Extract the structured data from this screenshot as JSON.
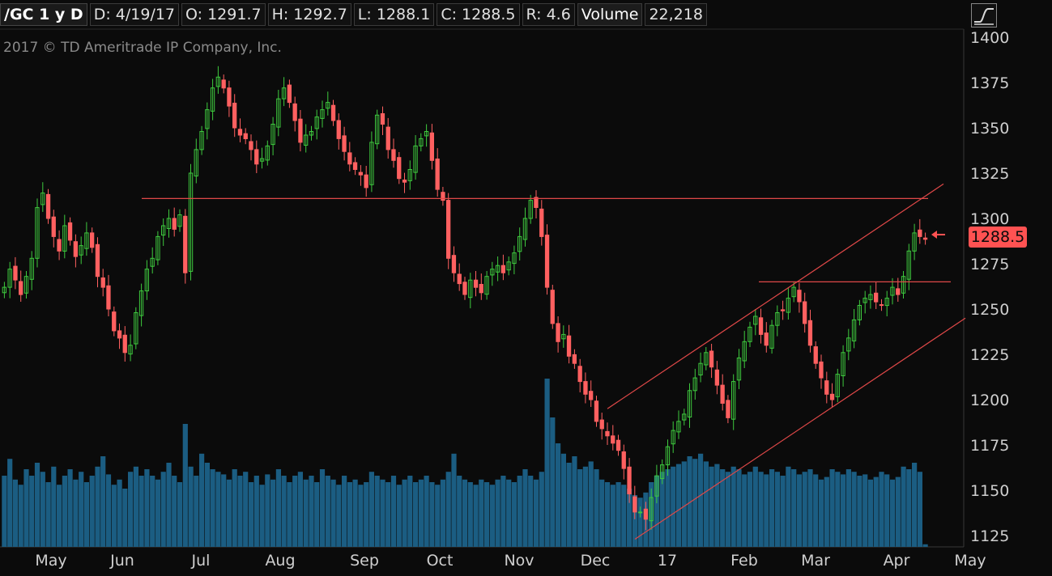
{
  "header": {
    "symbol": "/GC 1 y D",
    "date": "D: 4/19/17",
    "open": "O: 1291.7",
    "high": "H: 1292.7",
    "low": "L: 1288.1",
    "close": "C: 1288.5",
    "range": "R: 4.6",
    "volume_label": "Volume",
    "volume_value": "22,218"
  },
  "copyright": "2017 © TD Ameritrade IP Company, Inc.",
  "icons": {
    "study_button": "line-curve-icon",
    "price_arrow": "left-arrow-icon"
  },
  "colors": {
    "background": "#0b0b0b",
    "up": "#3ec93e",
    "down": "#ff6060",
    "volume": "#1b5d82",
    "trendline": "#e04848",
    "badge": "#ff5252"
  },
  "chart_data": {
    "type": "candlestick",
    "title": "",
    "ylim": [
      1120,
      1405
    ],
    "price_ticks": [
      1400,
      1375,
      1350,
      1325,
      1300,
      1275,
      1250,
      1225,
      1200,
      1175,
      1150,
      1125
    ],
    "x_tick_labels": [
      "May",
      "Jun",
      "Jul",
      "Aug",
      "Sep",
      "Oct",
      "Nov",
      "Dec",
      "17",
      "Feb",
      "Mar",
      "Apr",
      "May"
    ],
    "last_price": "1288.5",
    "closes": [
      1262,
      1272,
      1266,
      1258,
      1268,
      1278,
      1306,
      1314,
      1300,
      1290,
      1282,
      1296,
      1288,
      1279,
      1285,
      1292,
      1284,
      1268,
      1262,
      1250,
      1238,
      1234,
      1226,
      1230,
      1248,
      1260,
      1272,
      1278,
      1290,
      1296,
      1300,
      1294,
      1302,
      1270,
      1325,
      1338,
      1348,
      1360,
      1372,
      1378,
      1372,
      1362,
      1350,
      1346,
      1344,
      1338,
      1330,
      1333,
      1340,
      1352,
      1366,
      1372,
      1364,
      1354,
      1342,
      1346,
      1348,
      1356,
      1360,
      1364,
      1354,
      1344,
      1337,
      1330,
      1327,
      1324,
      1317,
      1342,
      1357,
      1352,
      1338,
      1332,
      1322,
      1320,
      1327,
      1340,
      1344,
      1348,
      1332,
      1316,
      1310,
      1278,
      1270,
      1264,
      1258,
      1266,
      1262,
      1259,
      1268,
      1272,
      1274,
      1270,
      1276,
      1281,
      1290,
      1300,
      1310,
      1306,
      1290,
      1262,
      1242,
      1232,
      1236,
      1224,
      1220,
      1210,
      1203,
      1200,
      1188,
      1184,
      1180,
      1176,
      1172,
      1162,
      1148,
      1138,
      1138,
      1134,
      1146,
      1158,
      1164,
      1174,
      1183,
      1188,
      1192,
      1205,
      1212,
      1220,
      1226,
      1218,
      1208,
      1198,
      1190,
      1210,
      1223,
      1232,
      1240,
      1246,
      1236,
      1230,
      1241,
      1248,
      1249,
      1256,
      1262,
      1254,
      1242,
      1230,
      1220,
      1212,
      1203,
      1200,
      1214,
      1226,
      1234,
      1244,
      1252,
      1256,
      1258,
      1254,
      1252,
      1256,
      1262,
      1258,
      1268,
      1282,
      1292,
      1290,
      1288.5
    ],
    "volumes": [
      55,
      68,
      52,
      48,
      60,
      55,
      65,
      58,
      50,
      62,
      48,
      55,
      60,
      52,
      58,
      50,
      55,
      62,
      70,
      56,
      48,
      52,
      45,
      58,
      62,
      55,
      60,
      55,
      52,
      58,
      65,
      55,
      50,
      95,
      62,
      55,
      72,
      65,
      60,
      58,
      56,
      52,
      60,
      55,
      58,
      50,
      55,
      48,
      56,
      52,
      60,
      55,
      50,
      55,
      58,
      52,
      55,
      50,
      60,
      55,
      52,
      48,
      55,
      50,
      52,
      48,
      50,
      58,
      55,
      52,
      50,
      55,
      48,
      52,
      55,
      50,
      52,
      55,
      50,
      48,
      52,
      58,
      72,
      55,
      52,
      50,
      48,
      52,
      50,
      48,
      52,
      55,
      52,
      50,
      55,
      60,
      55,
      52,
      58,
      130,
      100,
      80,
      72,
      65,
      70,
      60,
      62,
      66,
      60,
      52,
      50,
      48,
      50,
      48,
      45,
      40,
      38,
      42,
      50,
      55,
      58,
      60,
      62,
      64,
      66,
      70,
      68,
      72,
      66,
      62,
      64,
      60,
      58,
      62,
      60,
      56,
      58,
      62,
      58,
      56,
      60,
      58,
      55,
      62,
      60,
      56,
      58,
      60,
      56,
      52,
      54,
      60,
      58,
      56,
      60,
      58,
      55,
      56,
      52,
      54,
      58,
      56,
      52,
      54,
      62,
      60,
      65,
      58,
      2
    ],
    "resistance_level": 1311,
    "neckline_level": 1265,
    "channel": {
      "upper": [
        [
          "2016-12-01",
          1195
        ],
        [
          "2017-04-25",
          1319
        ]
      ],
      "lower": [
        [
          "2016-12-19",
          1123
        ],
        [
          "2017-04-28",
          1245
        ]
      ]
    }
  }
}
